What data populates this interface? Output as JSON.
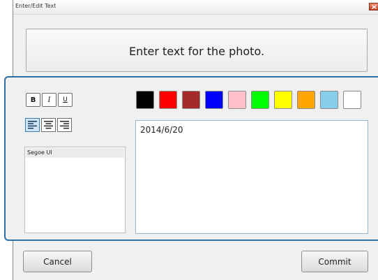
{
  "window": {
    "title": "Enter/Edit Text"
  },
  "header": {
    "text": "Enter text for the photo."
  },
  "format": {
    "bold": "B",
    "italic": "I",
    "underline": "U",
    "alignment_selected": "left"
  },
  "colors": [
    {
      "name": "black",
      "hex": "#000000"
    },
    {
      "name": "red",
      "hex": "#ff0000"
    },
    {
      "name": "brown",
      "hex": "#a52a2a"
    },
    {
      "name": "blue",
      "hex": "#0000ff"
    },
    {
      "name": "pink",
      "hex": "#ffc0cb"
    },
    {
      "name": "green",
      "hex": "#00ff00"
    },
    {
      "name": "yellow",
      "hex": "#ffff00"
    },
    {
      "name": "orange",
      "hex": "#ffa500"
    },
    {
      "name": "light-blue",
      "hex": "#87ceeb"
    },
    {
      "name": "white",
      "hex": "#ffffff"
    }
  ],
  "fonts": {
    "items": [
      "Segoe UI"
    ],
    "selected": "Segoe UI"
  },
  "text": {
    "value": "2014/6/20"
  },
  "buttons": {
    "cancel": "Cancel",
    "commit": "Commit"
  }
}
